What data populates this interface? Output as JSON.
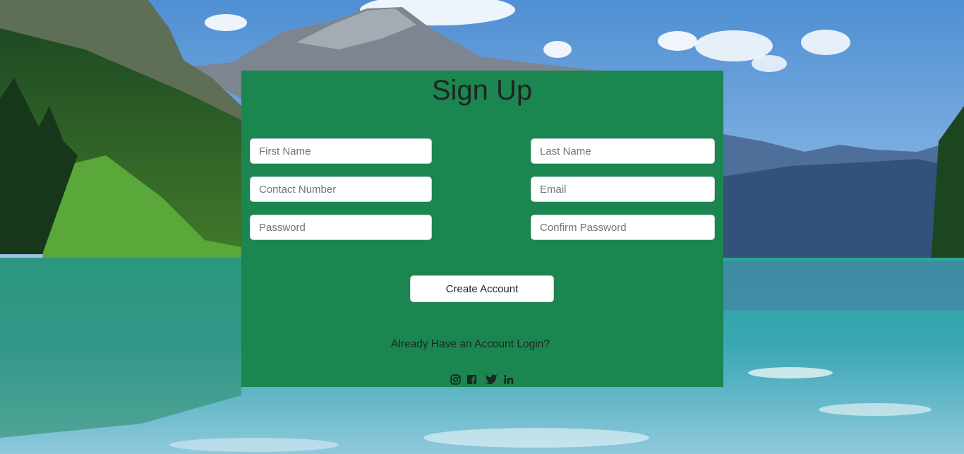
{
  "form": {
    "title": "Sign Up",
    "first_name_placeholder": "First Name",
    "last_name_placeholder": "Last Name",
    "contact_placeholder": "Contact Number",
    "email_placeholder": "Email",
    "password_placeholder": "Password",
    "confirm_password_placeholder": "Confirm Password",
    "submit_label": "Create Account",
    "login_link": "Already Have an Account Login?"
  },
  "social": {
    "icons": [
      "instagram-icon",
      "facebook-icon",
      "twitter-icon",
      "linkedin-icon"
    ]
  },
  "colors": {
    "card_bg": "#1b8650",
    "title_text": "#1d2622"
  }
}
